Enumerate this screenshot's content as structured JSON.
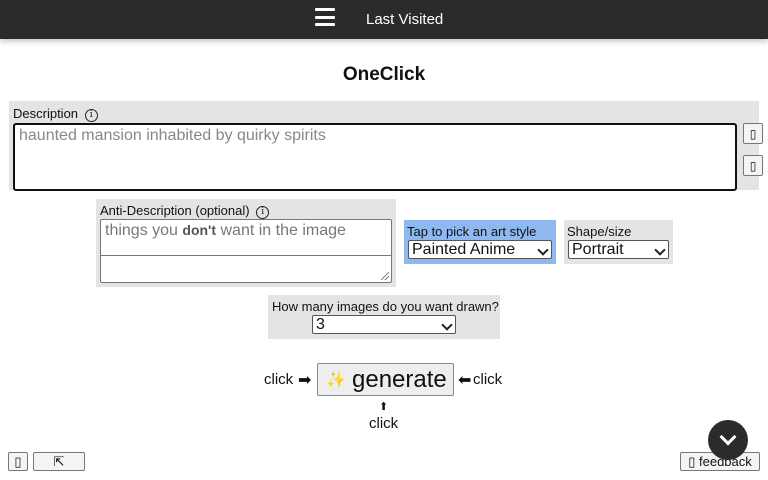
{
  "topbar": {
    "menu_icon": "hamburger-menu-icon",
    "last_visited": "Last Visited"
  },
  "page_title": "OneClick",
  "description": {
    "label": "Description",
    "info_icon": "ⓘ",
    "placeholder": "haunted mansion inhabited by quirky spirits",
    "value": "",
    "side_button_1": "▯",
    "side_button_2": "▯"
  },
  "anti_description": {
    "label": "Anti-Description (optional)",
    "info_icon": "ⓘ",
    "placeholder_before": "things you ",
    "placeholder_bold": "don't",
    "placeholder_after": " want in the image"
  },
  "art_style": {
    "label": "Tap to pick an art style",
    "selected": "Painted Anime"
  },
  "shape": {
    "label": "Shape/size",
    "selected": "Portrait"
  },
  "image_count": {
    "label": "How many images do you want drawn?",
    "selected": "3"
  },
  "generate": {
    "click_left": "click",
    "arrow_right": "➡",
    "sparkle": "✨",
    "label": "generate",
    "arrow_left": "⬅",
    "click_right": "click",
    "arrow_up": "⬆",
    "click_below": "click"
  },
  "footer": {
    "left_button": "▯",
    "corner_button": "⇱",
    "feedback_label": "▯ feedback"
  },
  "colors": {
    "topbar": "#2b2b2b",
    "panel": "#e4e4e4",
    "style_panel": "#8fb8ef"
  }
}
